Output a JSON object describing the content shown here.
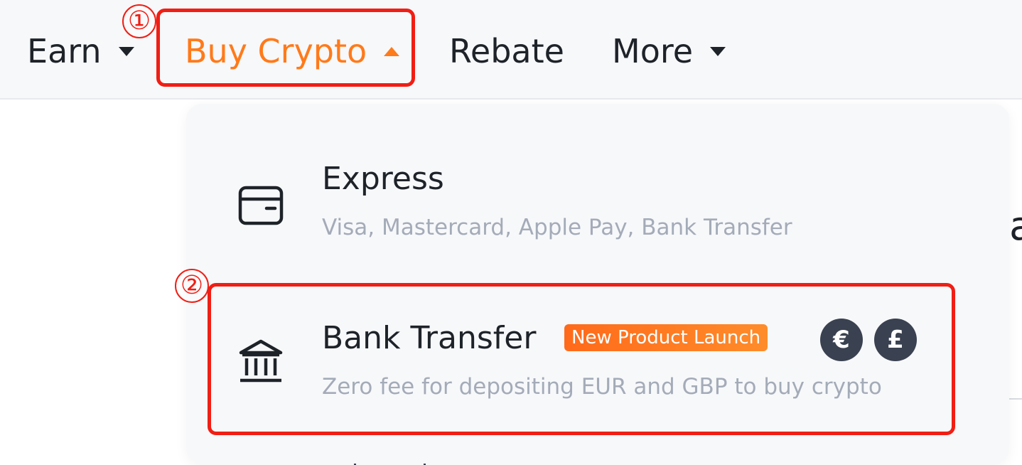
{
  "nav": {
    "earn": "Earn",
    "buy_crypto": "Buy Crypto",
    "rebate": "Rebate",
    "more": "More"
  },
  "annotations": {
    "step1": "①",
    "step2": "②",
    "highlight_color": "#f01e14"
  },
  "dropdown": {
    "express": {
      "title": "Express",
      "description": "Visa, Mastercard, Apple Pay, Bank Transfer",
      "icon": "card-icon"
    },
    "bank_transfer": {
      "title": "Bank Transfer",
      "badge": "New Product Launch",
      "description": "Zero fee for depositing EUR and GBP to buy crypto",
      "icon": "bank-icon",
      "currencies": [
        "€",
        "£"
      ]
    }
  },
  "colors": {
    "accent": "#ff7a1a",
    "text": "#1e2329",
    "muted": "#a4abb8",
    "badge_bg": "#ff6a1a",
    "currency_bg": "#3a4150"
  },
  "peek": {
    "letter": "a"
  }
}
